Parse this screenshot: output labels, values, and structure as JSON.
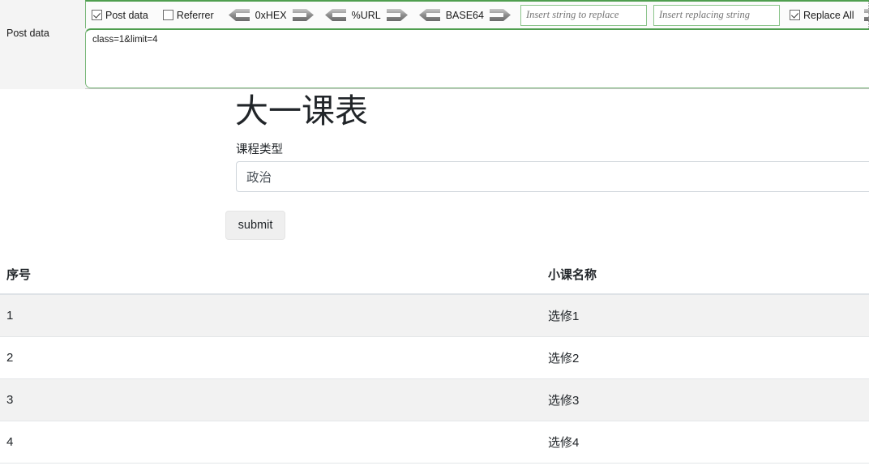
{
  "tool_panel": {
    "post_data_label": "Post data",
    "post_data_value": "class=1&limit=4",
    "options": {
      "post_data_checkbox_label": "Post data",
      "post_data_checked": true,
      "referrer_checkbox_label": "Referrer",
      "referrer_checked": false,
      "replace_all_label": "Replace All",
      "replace_all_checked": true
    },
    "codecs": [
      {
        "label": "0xHEX"
      },
      {
        "label": "%URL"
      },
      {
        "label": "BASE64"
      }
    ],
    "replace_find_placeholder": "Insert string to replace",
    "replace_find_value": "",
    "replace_with_placeholder": "Insert replacing string",
    "replace_with_value": ""
  },
  "page": {
    "title": "大一课表",
    "form_label": "课程类型",
    "course_type_value": "政治",
    "course_type_placeholder": "",
    "submit_label": "submit",
    "table": {
      "headers": [
        "序号",
        "小课名称"
      ],
      "rows": [
        {
          "index": "1",
          "name": "选修1"
        },
        {
          "index": "2",
          "name": "选修2"
        },
        {
          "index": "3",
          "name": "选修3"
        },
        {
          "index": "4",
          "name": "选修4"
        }
      ]
    }
  },
  "colors": {
    "panel_border_green": "#4f9e4f",
    "field_border_green": "#8bc48b",
    "panel_bg": "#f4f4f4",
    "row_stripe": "#f2f2f2",
    "text_dark": "#212529"
  }
}
